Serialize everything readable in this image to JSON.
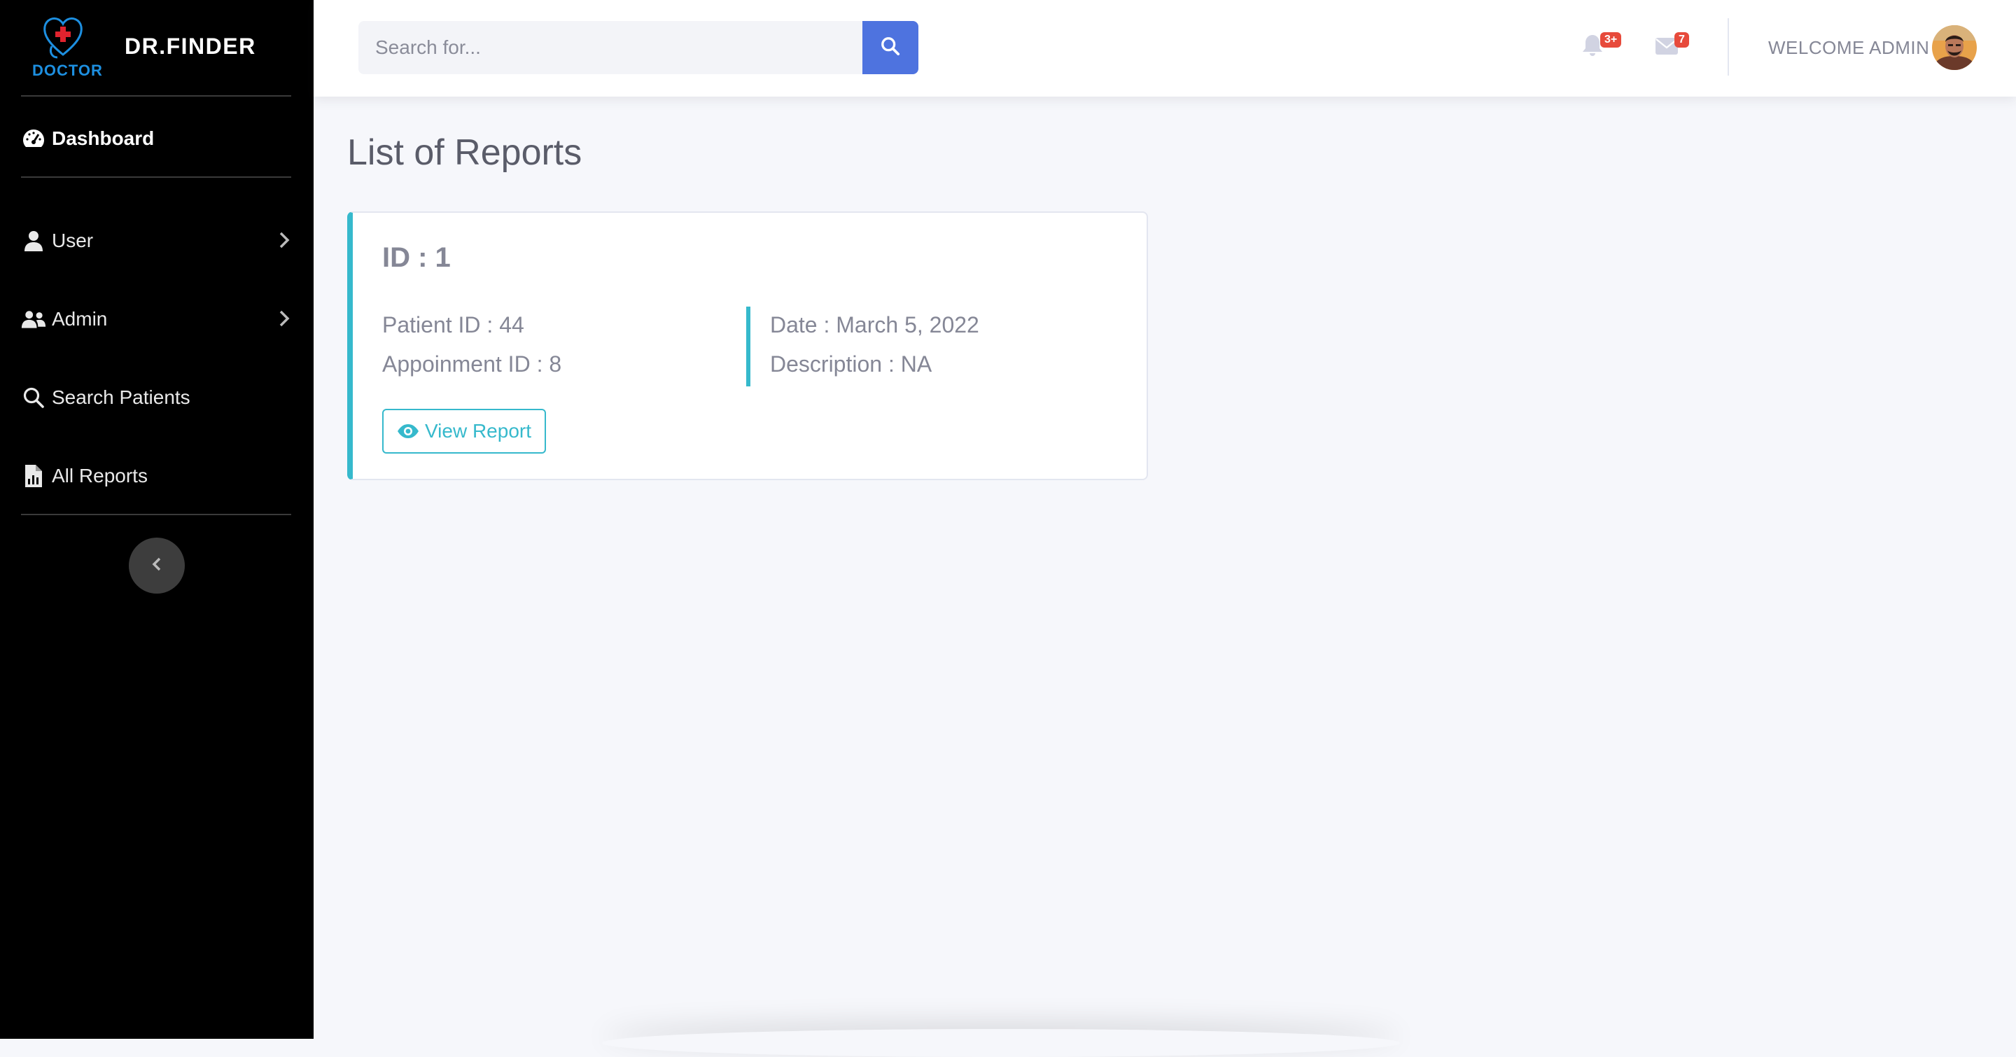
{
  "brand": {
    "logo_text": "DOCTOR",
    "name": "DR.FINDER"
  },
  "sidebar": {
    "items": [
      {
        "label": "Dashboard",
        "icon": "gauge-icon"
      },
      {
        "label": "User",
        "icon": "user-icon"
      },
      {
        "label": "Admin",
        "icon": "users-icon"
      },
      {
        "label": "Search Patients",
        "icon": "search-icon"
      },
      {
        "label": "All Reports",
        "icon": "file-chart-icon"
      }
    ]
  },
  "search": {
    "placeholder": "Search for..."
  },
  "topbar": {
    "alerts_badge": "3+",
    "messages_badge": "7",
    "welcome": "WELCOME ADMIN"
  },
  "main": {
    "title": "List of Reports",
    "reports": [
      {
        "id_label": "ID : 1",
        "patient_id": "Patient ID : 44",
        "appointment_id": "Appoinment ID : 8",
        "date": "Date : March 5, 2022",
        "description": "Description : NA",
        "button_label": "View Report"
      }
    ]
  },
  "colors": {
    "primary": "#4e73df",
    "info": "#36b9cc",
    "danger": "#e74a3b",
    "sidebar_bg": "#000000",
    "page_bg": "#f6f7fb"
  }
}
